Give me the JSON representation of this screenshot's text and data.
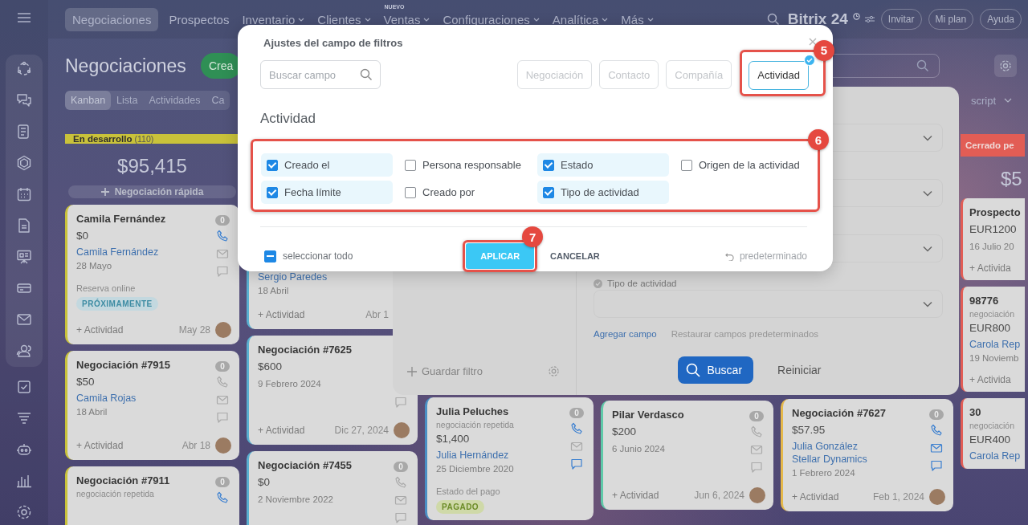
{
  "topbar": {
    "nav": [
      {
        "label": "Negociaciones",
        "selected": true,
        "menu": false
      },
      {
        "label": "Prospectos",
        "selected": false,
        "menu": false
      },
      {
        "label": "Inventario",
        "selected": false,
        "menu": true
      },
      {
        "label": "Clientes",
        "selected": false,
        "menu": true
      },
      {
        "label": "Ventas",
        "selected": false,
        "menu": true,
        "badge": "NUEVO"
      },
      {
        "label": "Configuraciones",
        "selected": false,
        "menu": true
      },
      {
        "label": "Analítica",
        "selected": false,
        "menu": true
      },
      {
        "label": "Más",
        "selected": false,
        "menu": true
      }
    ],
    "logo": "Bitrix 24",
    "buttons": [
      "Invitar",
      "Mi plan",
      "Ayuda"
    ]
  },
  "page": {
    "title": "Negociaciones",
    "create_button": "Crea",
    "view_tabs": [
      {
        "label": "Kanban",
        "selected": true
      },
      {
        "label": "Lista",
        "selected": false
      },
      {
        "label": "Actividades",
        "selected": false
      },
      {
        "label": "Ca",
        "selected": false
      }
    ],
    "toolbar_text": "script"
  },
  "columns": [
    {
      "title": "En desarrollo",
      "count": "(110)",
      "color": "#c9c23a",
      "total": "$95,415",
      "quick_add": "Negociación rápida",
      "cards": [
        {
          "title": "Camila Fernández",
          "amount": "$0",
          "contacts": [
            "Camila Fernández"
          ],
          "date": "28 Mayo",
          "note": "Reserva online",
          "badge": {
            "text": "PRÓXIMAMENTE",
            "kind": "upcoming"
          },
          "action": "+ Actividad",
          "due": "May 28",
          "counter": "0",
          "avatar": true,
          "icons": [
            {
              "kind": "phone",
              "active": true
            },
            {
              "kind": "mail",
              "active": false
            },
            {
              "kind": "chat",
              "active": false
            }
          ]
        },
        {
          "title": "Negociación #7915",
          "amount": "$50",
          "contacts": [
            "Camila Rojas"
          ],
          "date": "18 Abril",
          "action": "+ Actividad",
          "due": "Abr 18",
          "counter": "0",
          "avatar": true,
          "icons": [
            {
              "kind": "phone",
              "active": false
            },
            {
              "kind": "mail",
              "active": false
            },
            {
              "kind": "chat",
              "active": false
            }
          ]
        },
        {
          "title": "Negociación #7911",
          "subtitle": "negociación repetida",
          "counter": "0",
          "icons": [
            {
              "kind": "phone",
              "active": true
            }
          ]
        }
      ]
    },
    {
      "color": "#5ab0d0",
      "cards": [
        {
          "contacts": [
            "Sergio Paredes"
          ],
          "date": "18 Abril",
          "action": "+ Actividad",
          "due": "Abr 1"
        },
        {
          "title": "Negociación #7625",
          "amount": "$600",
          "date": "9 Febrero 2024",
          "action": "+ Actividad",
          "due": "Dic 27, 2024",
          "avatar": true,
          "icons": [
            {
              "kind": "chat",
              "active": false
            }
          ]
        },
        {
          "title": "Negociación #7455",
          "amount": "$0",
          "date": "2 Noviembre 2022",
          "counter": "0",
          "icons": [
            {
              "kind": "phone",
              "active": false
            },
            {
              "kind": "mail",
              "active": false
            },
            {
              "kind": "chat",
              "active": false
            }
          ]
        }
      ]
    },
    {
      "color": "#4a8fc4",
      "cards": [
        {
          "title": "Julia Peluches",
          "subtitle": "negociación repetida",
          "amount": "$1,400",
          "contacts": [
            "Julia Hernández"
          ],
          "date": "25 Diciembre 2020",
          "note": "Estado del pago",
          "badge": {
            "text": "PAGADO",
            "kind": "paid"
          },
          "counter": "0",
          "icons": [
            {
              "kind": "phone",
              "active": true
            },
            {
              "kind": "mail",
              "active": false
            },
            {
              "kind": "chat",
              "active": true
            }
          ]
        }
      ]
    },
    {
      "color": "#5fc9a8",
      "cards": [
        {
          "title": "Pilar Verdasco",
          "amount": "$200",
          "date": "6 Junio 2024",
          "action": "+ Actividad",
          "due": "Jun 6, 2024",
          "counter": "0",
          "avatar": true,
          "icons": [
            {
              "kind": "phone",
              "active": false
            },
            {
              "kind": "mail",
              "active": false
            },
            {
              "kind": "chat",
              "active": false
            }
          ]
        }
      ]
    },
    {
      "color": "#e5b84a",
      "cards": [
        {
          "title": "Negociación #7627",
          "amount": "$57.95",
          "contacts": [
            "Julia González",
            "Stellar Dynamics"
          ],
          "date": "1 Febrero 2024",
          "action": "+ Actividad",
          "due": "Feb 1, 2024",
          "counter": "0",
          "avatar": true,
          "icons": [
            {
              "kind": "phone",
              "active": true
            },
            {
              "kind": "mail",
              "active": true
            },
            {
              "kind": "chat",
              "active": true
            }
          ]
        }
      ]
    },
    {
      "title": "Cerrado pe",
      "color": "#e25d55",
      "total": "$5",
      "cards": [
        {
          "title": "Prospecto",
          "amount": "EUR1200",
          "date": "16 Julio 20",
          "action": "+ Activida"
        },
        {
          "title": "98776",
          "subtitle": "negociación",
          "amount": "EUR800",
          "contacts": [
            "Carola Rep"
          ],
          "date": "19 Noviemb",
          "action": "+ Activida"
        },
        {
          "title": "30",
          "subtitle": "negociación",
          "amount": "EUR400",
          "contacts": [
            "Carola Rep"
          ]
        }
      ]
    }
  ],
  "filter_panel": {
    "save_filter": "Guardar filtro",
    "fields": [
      {
        "kind": "select"
      },
      {
        "kind": "select"
      },
      {
        "kind": "select"
      },
      {
        "kind": "select",
        "label": "Tipo de actividad"
      }
    ],
    "add_field": "Agregar campo",
    "restore_fields": "Restaurar campos predeterminados",
    "search_button": "Buscar",
    "reset_button": "Reiniciar"
  },
  "dialog": {
    "title": "Ajustes del campo de filtros",
    "search": {
      "placeholder": "Buscar campo"
    },
    "sections": [
      {
        "label": "Negociación",
        "selected": false
      },
      {
        "label": "Contacto",
        "selected": false
      },
      {
        "label": "Compañía",
        "selected": false
      },
      {
        "label": "Actividad",
        "selected": true
      }
    ],
    "heading": "Actividad",
    "fields": [
      {
        "label": "Creado el",
        "checked": true
      },
      {
        "label": "Persona responsable",
        "checked": false
      },
      {
        "label": "Estado",
        "checked": true
      },
      {
        "label": "Origen de la actividad",
        "checked": false
      },
      {
        "label": "Fecha límite",
        "checked": true
      },
      {
        "label": "Creado por",
        "checked": false
      },
      {
        "label": "Tipo de actividad",
        "checked": true
      }
    ],
    "select_all": {
      "label": "seleccionar todo",
      "indeterminate": true
    },
    "apply_button": "APLICAR",
    "cancel_button": "CANCELAR",
    "reset_link": "predeterminado",
    "annotations": {
      "sections": "5",
      "fields": "6",
      "apply": "7"
    }
  }
}
